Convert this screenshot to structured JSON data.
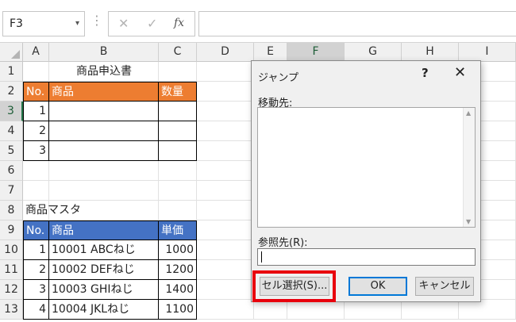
{
  "formula_bar": {
    "name_box": "F3",
    "dropdown_glyph": "▾",
    "more_glyph": "⋮",
    "cancel_glyph": "✕",
    "enter_glyph": "✓",
    "fx_glyph": "fx",
    "formula_value": ""
  },
  "columns": [
    "A",
    "B",
    "C",
    "D",
    "E",
    "F",
    "G",
    "H",
    "I"
  ],
  "rows": [
    "1",
    "2",
    "3",
    "4",
    "5",
    "6",
    "7",
    "8",
    "9",
    "10",
    "11",
    "12",
    "13"
  ],
  "cells": {
    "title": "商品申込書",
    "order_header": {
      "no": "No.",
      "product": "商品",
      "qty": "数量"
    },
    "order_rows": [
      {
        "no": "1",
        "product": "",
        "qty": ""
      },
      {
        "no": "2",
        "product": "",
        "qty": ""
      },
      {
        "no": "3",
        "product": "",
        "qty": ""
      }
    ],
    "master_title": "商品マスタ",
    "master_header": {
      "no": "No.",
      "product": "商品",
      "price": "単価"
    },
    "master_rows": [
      {
        "no": "1",
        "product": "10001 ABCねじ",
        "price": "1000"
      },
      {
        "no": "2",
        "product": "10002 DEFねじ",
        "price": "1200"
      },
      {
        "no": "3",
        "product": "10003 GHIねじ",
        "price": "1400"
      },
      {
        "no": "4",
        "product": "10004 JKLねじ",
        "price": "1100"
      }
    ]
  },
  "dialog": {
    "title": "ジャンプ",
    "help": "?",
    "close": "✕",
    "goto_label": "移動先:",
    "reference_label": "参照先(R):",
    "reference_value": "",
    "special_button": "セル選択(S)...",
    "ok_button": "OK",
    "cancel_button": "キャンセル",
    "scroll_up": "▲",
    "scroll_down": "▼"
  },
  "colors": {
    "order_header": "#ed7d31",
    "master_header": "#4472c4",
    "highlight": "#e8000d",
    "selection": "#217346"
  }
}
